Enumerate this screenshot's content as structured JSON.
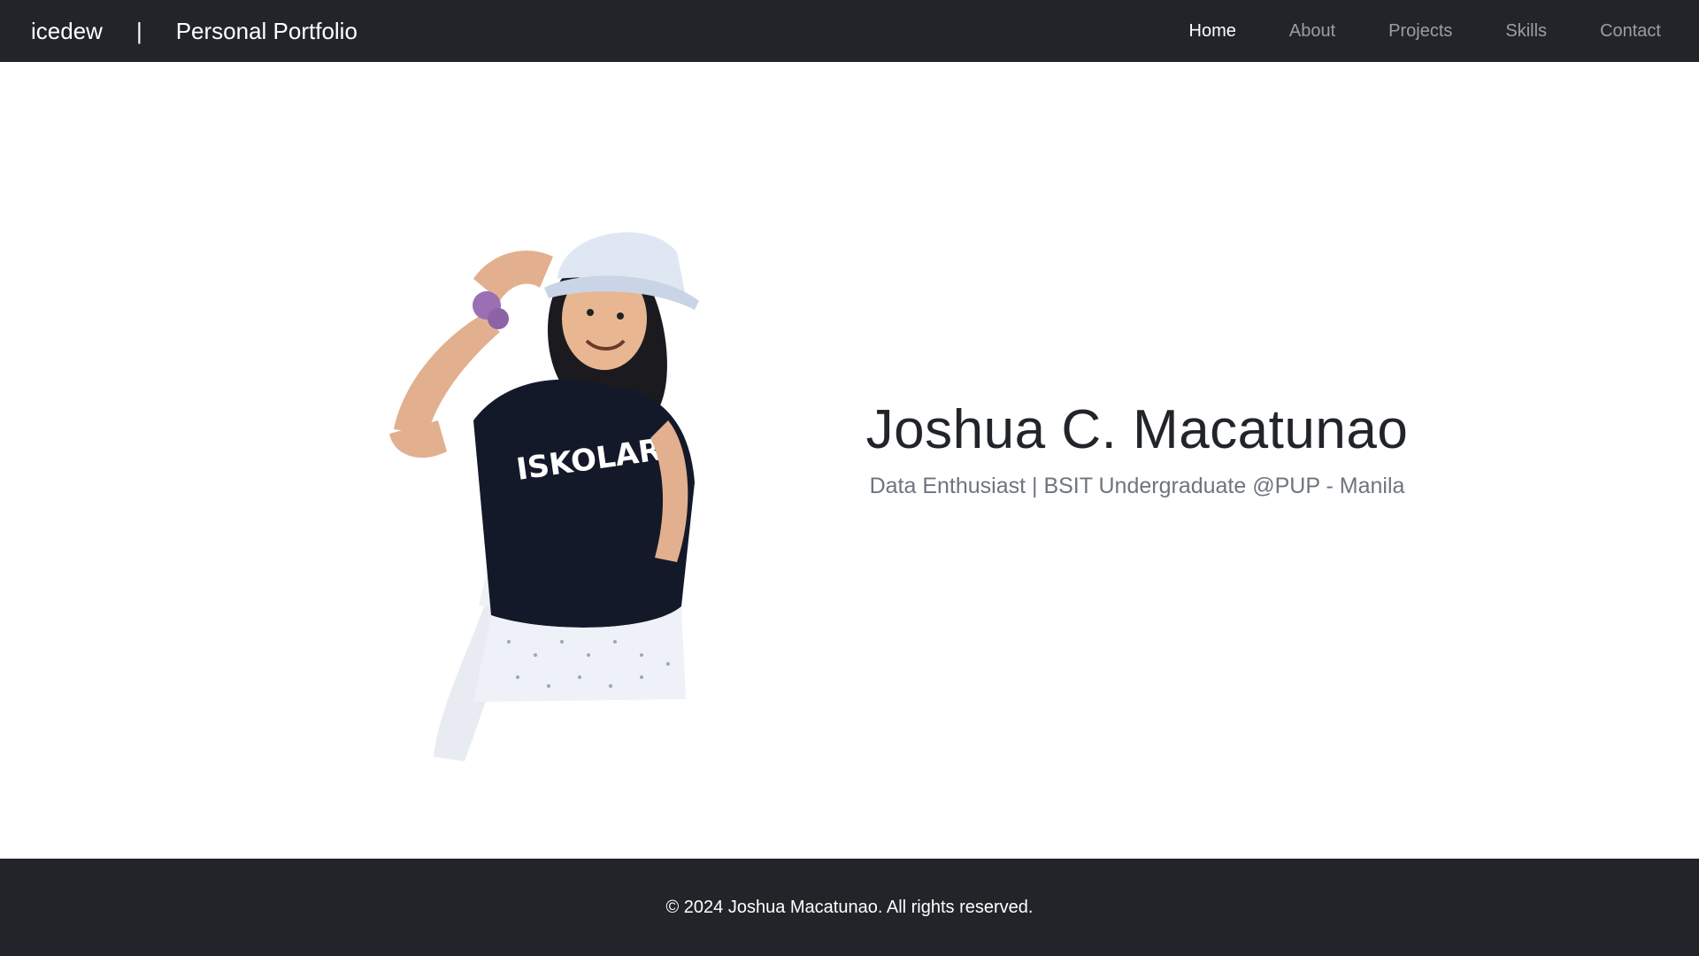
{
  "navbar": {
    "brand_name": "icedew",
    "brand_separator": "|",
    "brand_title": "Personal Portfolio",
    "links": [
      {
        "label": "Home",
        "active": true
      },
      {
        "label": "About",
        "active": false
      },
      {
        "label": "Projects",
        "active": false
      },
      {
        "label": "Skills",
        "active": false
      },
      {
        "label": "Contact",
        "active": false
      }
    ]
  },
  "hero": {
    "photo_icon": "person-photo",
    "shirt_text": "ISKOLAR",
    "name": "Joshua C. Macatunao",
    "subtitle": "Data Enthusiast | BSIT Undergraduate @PUP - Manila"
  },
  "footer": {
    "copyright": "© 2024 Joshua Macatunao. All rights reserved."
  },
  "colors": {
    "navbar_bg": "#212529",
    "footer_bg": "#212529",
    "nav_active": "#ffffff",
    "nav_inactive": "#9a9da0",
    "subtitle": "#6c757d"
  }
}
